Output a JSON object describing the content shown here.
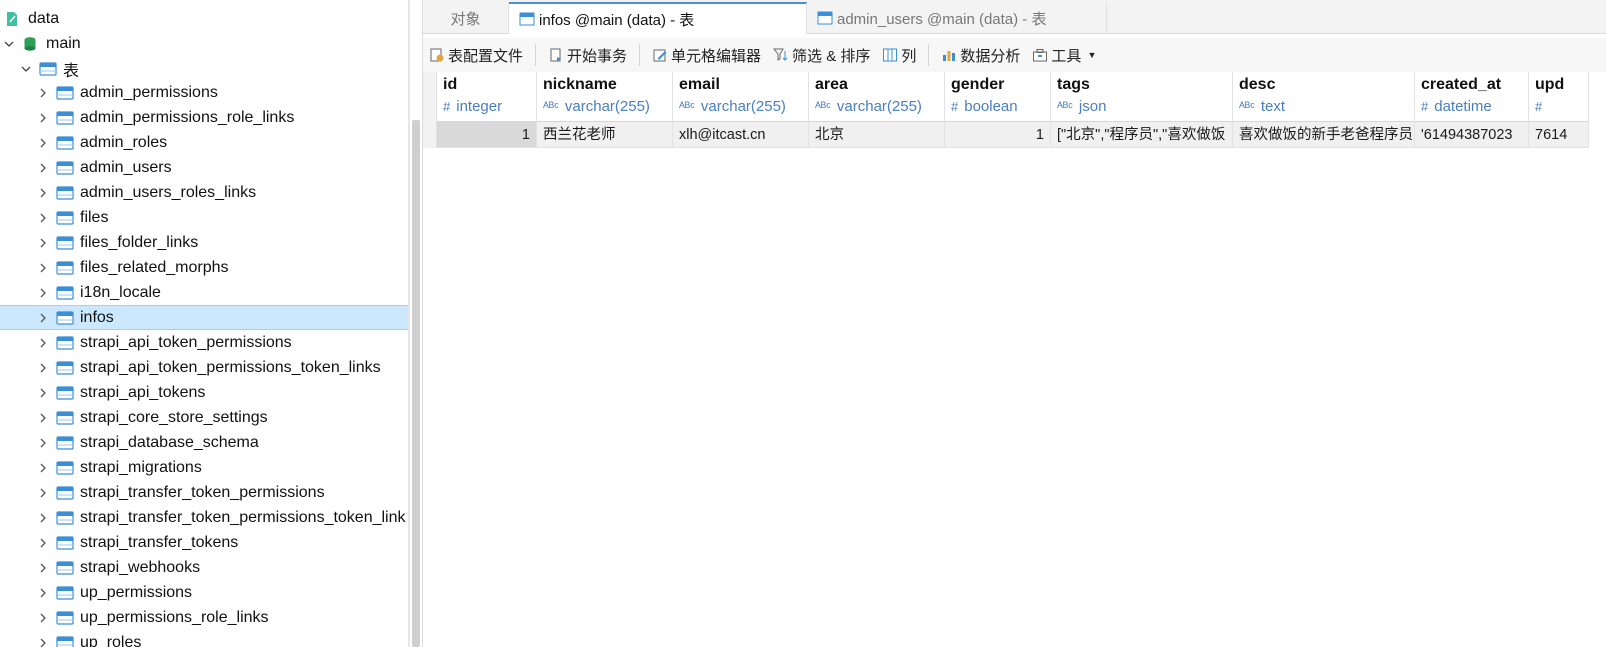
{
  "sidebar": {
    "root_label": "data",
    "schema_label": "main",
    "tables_label": "表",
    "tables": [
      "admin_permissions",
      "admin_permissions_role_links",
      "admin_roles",
      "admin_users",
      "admin_users_roles_links",
      "files",
      "files_folder_links",
      "files_related_morphs",
      "i18n_locale",
      "infos",
      "strapi_api_token_permissions",
      "strapi_api_token_permissions_token_links",
      "strapi_api_tokens",
      "strapi_core_store_settings",
      "strapi_database_schema",
      "strapi_migrations",
      "strapi_transfer_token_permissions",
      "strapi_transfer_token_permissions_token_link",
      "strapi_transfer_tokens",
      "strapi_webhooks",
      "up_permissions",
      "up_permissions_role_links",
      "up_roles"
    ],
    "selected_table": "infos"
  },
  "tabs": [
    {
      "label": "对象",
      "active": false
    },
    {
      "label": "infos @main (data) - 表",
      "active": true
    },
    {
      "label": "admin_users @main (data) - 表",
      "active": false
    }
  ],
  "toolbar": {
    "table_config": "表配置文件",
    "begin_transaction": "开始事务",
    "cell_editor": "单元格编辑器",
    "filter_sort": "筛选 & 排序",
    "columns": "列",
    "data_analysis": "数据分析",
    "tools": "工具"
  },
  "grid": {
    "columns": [
      {
        "name": "id",
        "type": "integer",
        "type_icon": "#"
      },
      {
        "name": "nickname",
        "type": "varchar(255)",
        "type_icon": "ABC"
      },
      {
        "name": "email",
        "type": "varchar(255)",
        "type_icon": "ABC"
      },
      {
        "name": "area",
        "type": "varchar(255)",
        "type_icon": "ABC"
      },
      {
        "name": "gender",
        "type": "boolean",
        "type_icon": "#"
      },
      {
        "name": "tags",
        "type": "json",
        "type_icon": "ABC"
      },
      {
        "name": "desc",
        "type": "text",
        "type_icon": "ABC"
      },
      {
        "name": "created_at",
        "type": "datetime",
        "type_icon": "#"
      },
      {
        "name": "upd",
        "type": "",
        "type_icon": "#"
      }
    ],
    "rows": [
      [
        "1",
        "西兰花老师",
        "xlh@itcast.cn",
        "北京",
        "1",
        "[\"北京\",\"程序员\",\"喜欢做饭",
        "喜欢做饭的新手老爸程序员",
        "'61494387023",
        "7614"
      ]
    ]
  },
  "colors": {
    "accent": "#4a90d9",
    "selected_bg": "#cce8ff",
    "type_text": "#4a7fc1",
    "table_icon": "#3a8fd6",
    "db_icon": "#2e9e57"
  }
}
